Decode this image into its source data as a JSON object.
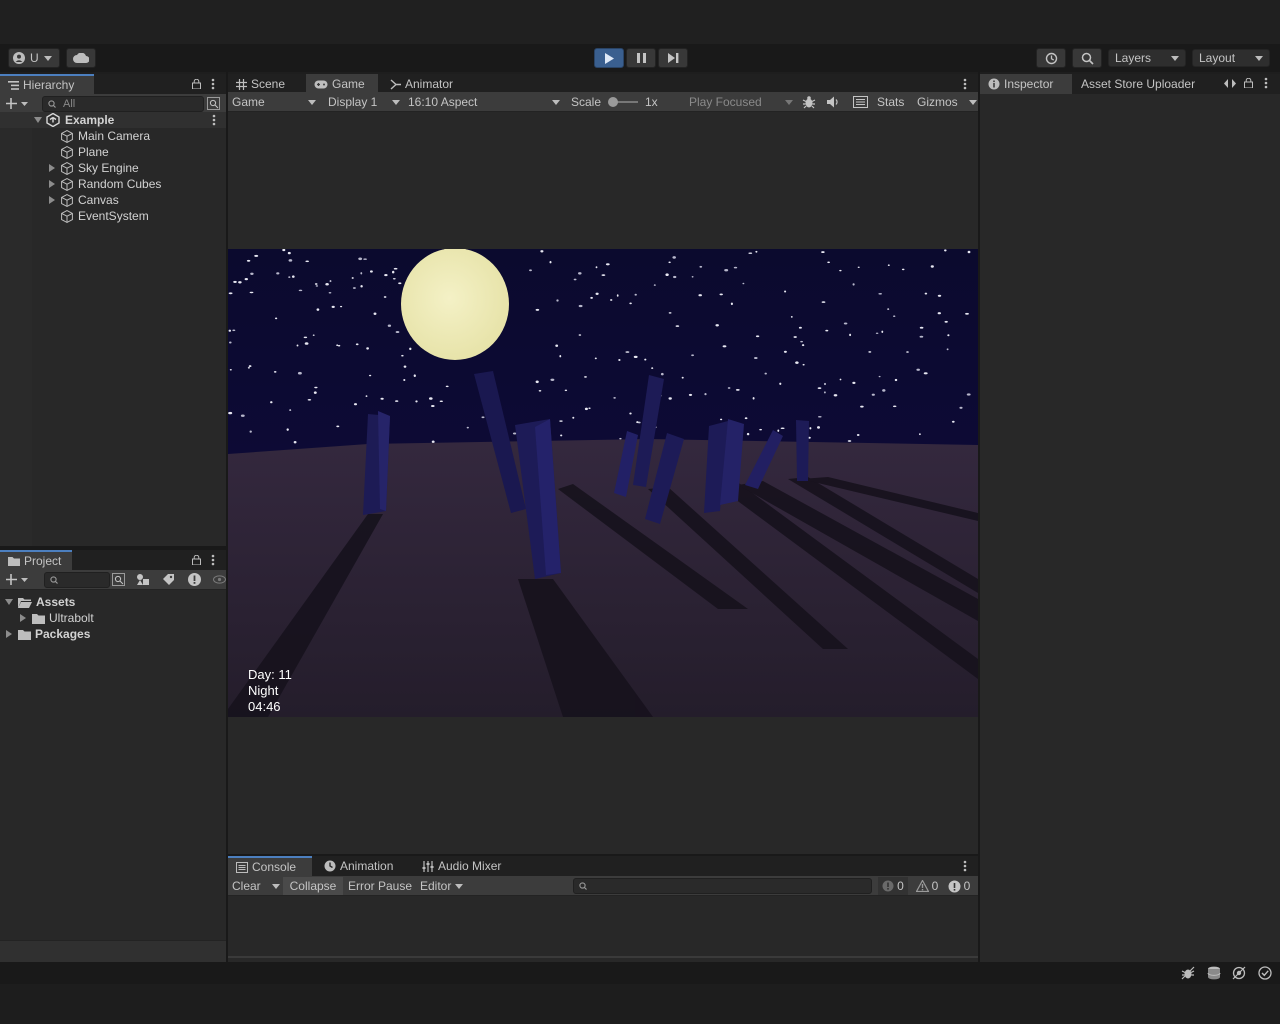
{
  "toolbar": {
    "account_label": "U",
    "layers_label": "Layers",
    "layout_label": "Layout"
  },
  "hierarchy": {
    "tab_label": "Hierarchy",
    "search_placeholder": "All",
    "scene_name": "Example",
    "items": [
      {
        "label": "Main Camera",
        "expandable": false
      },
      {
        "label": "Plane",
        "expandable": false
      },
      {
        "label": "Sky Engine",
        "expandable": true
      },
      {
        "label": "Random Cubes",
        "expandable": true
      },
      {
        "label": "Canvas",
        "expandable": true
      },
      {
        "label": "EventSystem",
        "expandable": false
      }
    ]
  },
  "project": {
    "tab_label": "Project",
    "tree": {
      "assets": "Assets",
      "ultrabolt": "Ultrabolt",
      "packages": "Packages"
    }
  },
  "center_tabs": {
    "scene": "Scene",
    "game": "Game",
    "animator": "Animator"
  },
  "game_toolbar": {
    "view_mode": "Game",
    "display": "Display 1",
    "aspect": "16:10 Aspect",
    "scale_label": "Scale",
    "scale_value": "1x",
    "play_mode": "Play Focused",
    "stats": "Stats",
    "gizmos": "Gizmos"
  },
  "game_hud": {
    "day": "Day: 11",
    "phase": "Night",
    "time": "04:46"
  },
  "inspector": {
    "tab_inspector": "Inspector",
    "tab_asset_store": "Asset Store Uploader"
  },
  "console": {
    "tab_console": "Console",
    "tab_animation": "Animation",
    "tab_audio_mixer": "Audio Mixer",
    "clear": "Clear",
    "collapse": "Collapse",
    "error_pause": "Error Pause",
    "editor": "Editor",
    "count_info": "0",
    "count_warn": "0",
    "count_error": "0"
  },
  "colors": {
    "accent": "#4c7fbf",
    "play_active": "#3a5f8f",
    "sky": "#0b0a2e",
    "moon": "#eeeab0",
    "ground": "#2b2233"
  }
}
